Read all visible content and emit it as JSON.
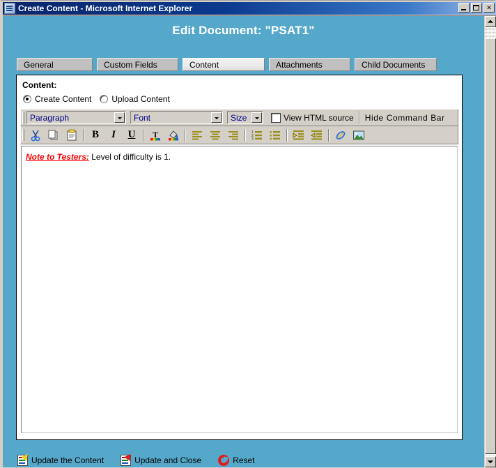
{
  "window": {
    "title": "Create Content - Microsoft Internet Explorer",
    "icon": "ie-document-icon",
    "buttons": {
      "minimize": "minimize-button",
      "maximize": "maximize-button",
      "close_label": "✕"
    }
  },
  "page": {
    "heading": "Edit Document: \"PSAT1\"",
    "background_color": "#56A8CB"
  },
  "tabs": [
    {
      "label": "General",
      "active": false
    },
    {
      "label": "Custom Fields",
      "active": false
    },
    {
      "label": "Content",
      "active": true
    },
    {
      "label": "Attachments",
      "active": false
    },
    {
      "label": "Child Documents",
      "active": false
    }
  ],
  "content_panel": {
    "label": "Content:",
    "radios": [
      {
        "label": "Create Content",
        "selected": true
      },
      {
        "label": "Upload Content",
        "selected": false
      }
    ],
    "toolbar_top": {
      "paragraph_select": {
        "value": "Paragraph",
        "name": "paragraph-style-select"
      },
      "font_select": {
        "value": "Font",
        "name": "font-family-select"
      },
      "size_select": {
        "value": "Size",
        "name": "font-size-select"
      },
      "view_html_source": {
        "label": "View HTML source",
        "checked": false
      },
      "hide_command_bar": {
        "label": "Hide Command Bar"
      }
    },
    "toolbar_icons": [
      {
        "name": "cut-icon",
        "title": "Cut"
      },
      {
        "name": "copy-icon",
        "title": "Copy"
      },
      {
        "name": "paste-icon",
        "title": "Paste"
      },
      {
        "name": "bold-icon",
        "glyph": "B",
        "title": "Bold"
      },
      {
        "name": "italic-icon",
        "glyph": "I",
        "title": "Italic"
      },
      {
        "name": "underline-icon",
        "glyph": "U",
        "title": "Underline"
      },
      {
        "name": "font-color-icon",
        "glyph": "T",
        "title": "Font Color"
      },
      {
        "name": "highlight-color-icon",
        "title": "Highlight Color"
      },
      {
        "name": "align-left-icon",
        "title": "Align Left"
      },
      {
        "name": "align-center-icon",
        "title": "Align Center"
      },
      {
        "name": "align-right-icon",
        "title": "Align Right"
      },
      {
        "name": "numbered-list-icon",
        "title": "Numbered List"
      },
      {
        "name": "bulleted-list-icon",
        "title": "Bulleted List"
      },
      {
        "name": "indent-icon",
        "title": "Indent"
      },
      {
        "name": "outdent-icon",
        "title": "Outdent"
      },
      {
        "name": "hyperlink-icon",
        "title": "Insert Hyperlink"
      },
      {
        "name": "image-icon",
        "title": "Insert Image"
      }
    ],
    "editor": {
      "note_label": "Note to Testers:",
      "note_body": " Level of difficulty is 1.",
      "note_label_color": "#FF0000"
    }
  },
  "actions": [
    {
      "label": "Update the Content",
      "icon": "update-content-icon"
    },
    {
      "label": "Update and Close",
      "icon": "update-and-close-icon"
    },
    {
      "label": "Reset",
      "icon": "reset-icon"
    }
  ],
  "scrollbar": {
    "up_arrow": "scroll-up-arrow",
    "down_arrow": "scroll-down-arrow",
    "thumb": "scroll-thumb"
  }
}
